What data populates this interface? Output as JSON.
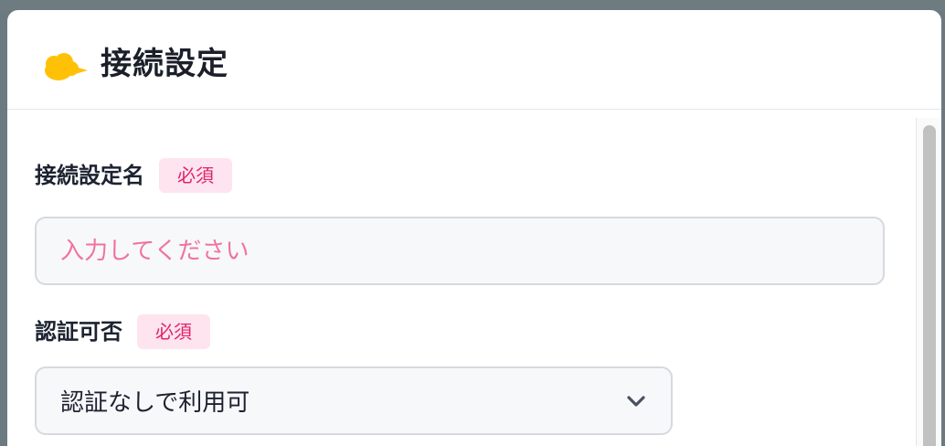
{
  "modal": {
    "title": "接続設定",
    "icon": "cloud-icon",
    "accent_color": "#ffc107"
  },
  "form": {
    "name_field": {
      "label": "接続設定名",
      "required_badge": "必須",
      "placeholder": "入力してください",
      "value": ""
    },
    "auth_field": {
      "label": "認証可否",
      "required_badge": "必須",
      "selected_value": "認証なしで利用可",
      "icon": "chevron-down-icon"
    }
  },
  "colors": {
    "required_text": "#e0246b",
    "required_bg": "#fde4ee",
    "placeholder": "#f0739f"
  }
}
